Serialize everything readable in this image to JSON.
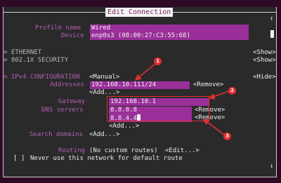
{
  "window": {
    "title": "Edit Connection"
  },
  "profile": {
    "label": "Profile name",
    "value": "Wired"
  },
  "device": {
    "label": "Device",
    "value": "enp0s3 (08:00:27:C3:55:68)"
  },
  "ethernet": {
    "label": "= ETHERNET",
    "toggle": "<Show>"
  },
  "security": {
    "label": "= 802.1X SECURITY",
    "toggle": "<Show>"
  },
  "ipv4": {
    "label": "= IPv4 CONFIGURATION",
    "mode": "<Manual>",
    "toggle": "<Hide>",
    "addresses_label": "Addresses",
    "address": "192.168.10.111/24",
    "address_remove": "<Remove>",
    "address_add": "<Add...>",
    "gateway_label": "Gateway",
    "gateway": "192.168.10.1",
    "dns_label": "DNS servers",
    "dns": [
      "8.8.8.8",
      "8.8.4.4"
    ],
    "dns_remove": "<Remove>",
    "dns_add": "<Add...>",
    "search_label": "Search domains",
    "search_add": "<Add...>",
    "routing_label": "Routing",
    "routing_value": "(No custom routes)",
    "routing_edit": "<Edit...>",
    "never_default_checkbox": "[ ]",
    "never_default_label": "Never use this network for default route"
  },
  "scrollbar": {
    "up": "↑",
    "down": "↓"
  },
  "annotations": [
    "1",
    "2",
    "3"
  ],
  "colors": {
    "field": "#9a2f9a",
    "background": "#2a2a2a",
    "annotation": "#e23030"
  }
}
